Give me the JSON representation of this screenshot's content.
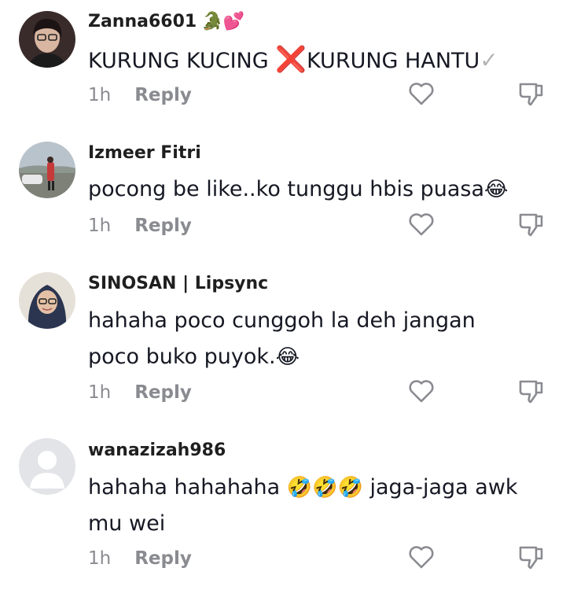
{
  "comments": [
    {
      "username": "Zanna6601",
      "username_emoji": "🐊💕",
      "text_parts": [
        "KURUNG KUCING ",
        "❌",
        "KURUNG HANTU",
        "✓"
      ],
      "time": "1h",
      "reply_label": "Reply",
      "avatar": "woman-glasses-avatar"
    },
    {
      "username": "Izmeer Fitri",
      "text": "pocong be like..ko tunggu hbis puasa",
      "text_emoji": "😂",
      "time": "1h",
      "reply_label": "Reply",
      "avatar": "outdoor-person-avatar"
    },
    {
      "username": "SINOSAN | Lipsync",
      "text_line1": "hahaha poco cunggoh la deh jangan",
      "text_line2": "poco buko puyok.",
      "text_emoji": "😂",
      "time": "1h",
      "reply_label": "Reply",
      "avatar": "hijab-woman-avatar"
    },
    {
      "username": "wanazizah986",
      "text_a": "hahaha hahahaha ",
      "text_emoji": "🤣🤣🤣",
      "text_b": " jaga-jaga awk",
      "text_line2": "mu wei",
      "time": "1h",
      "reply_label": "Reply",
      "avatar": "default-avatar"
    }
  ],
  "colors": {
    "text": "#161823",
    "meta": "#8a8b91",
    "icon": "#8a8b91",
    "red_x": "#e0242d"
  }
}
